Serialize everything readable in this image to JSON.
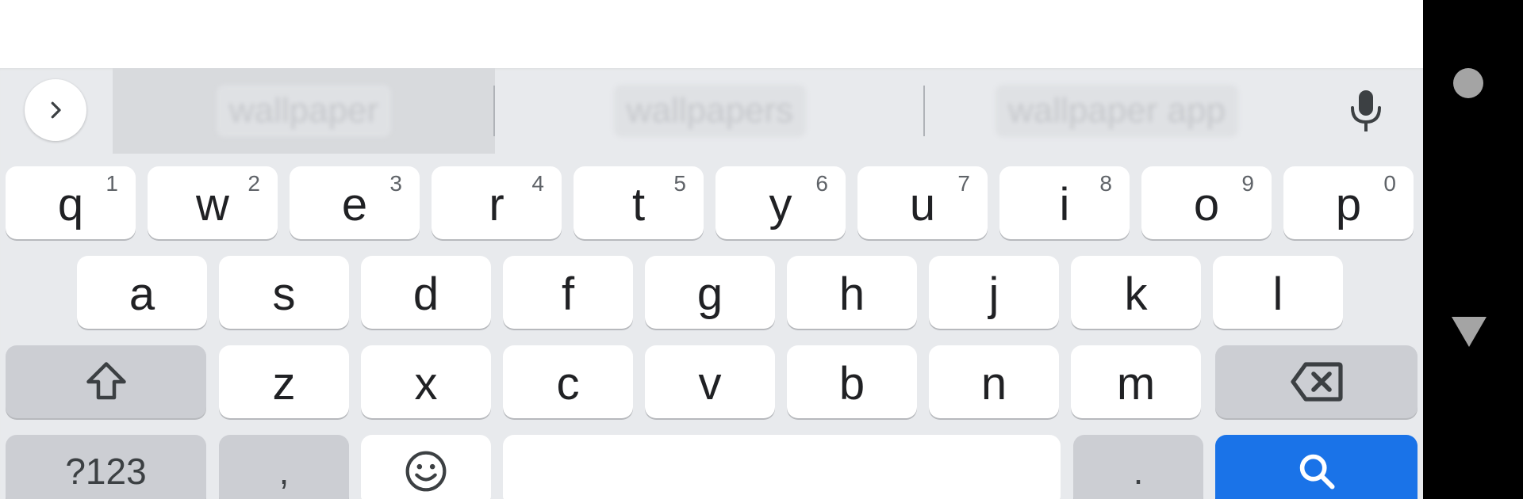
{
  "suggestions": [
    "wallpaper",
    "wallpapers",
    "wallpaper app"
  ],
  "keyboard": {
    "row1": [
      {
        "letter": "q",
        "hint": "1"
      },
      {
        "letter": "w",
        "hint": "2"
      },
      {
        "letter": "e",
        "hint": "3"
      },
      {
        "letter": "r",
        "hint": "4"
      },
      {
        "letter": "t",
        "hint": "5"
      },
      {
        "letter": "y",
        "hint": "6"
      },
      {
        "letter": "u",
        "hint": "7"
      },
      {
        "letter": "i",
        "hint": "8"
      },
      {
        "letter": "o",
        "hint": "9"
      },
      {
        "letter": "p",
        "hint": "0"
      }
    ],
    "row2": [
      "a",
      "s",
      "d",
      "f",
      "g",
      "h",
      "j",
      "k",
      "l"
    ],
    "row3": [
      "z",
      "x",
      "c",
      "v",
      "b",
      "n",
      "m"
    ],
    "symbols_label": "?123",
    "comma_label": ",",
    "period_label": "."
  },
  "icons": {
    "expand": "chevron-right-icon",
    "mic": "mic-icon",
    "shift": "shift-icon",
    "backspace": "backspace-icon",
    "emoji": "emoji-icon",
    "search": "search-icon",
    "home": "home-icon",
    "back": "back-icon"
  },
  "colors": {
    "keyboard_bg": "#e8eaed",
    "key_bg": "#ffffff",
    "modifier_key_bg": "#ccced3",
    "search_key_bg": "#1a73e8",
    "nav_bar_bg": "#000000"
  }
}
